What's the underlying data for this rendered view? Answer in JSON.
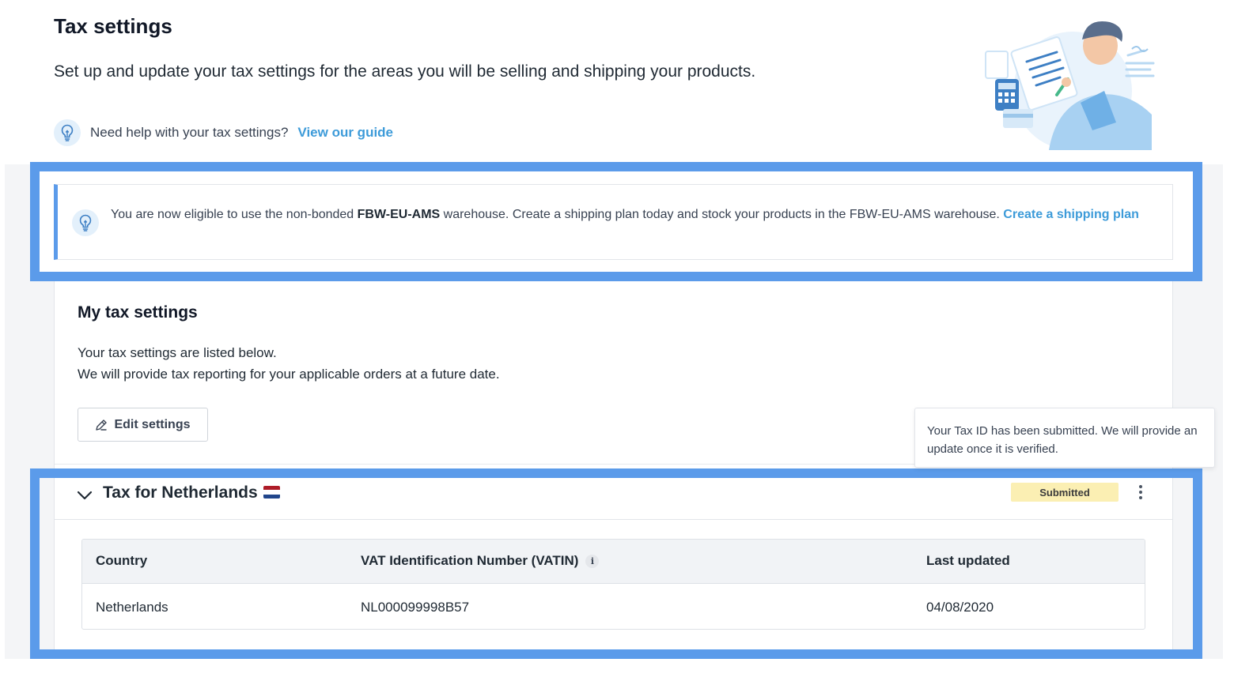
{
  "header": {
    "title": "Tax settings",
    "subtitle": "Set up and update your tax settings for the areas you will be selling and shipping your products.",
    "help_text": "Need help with your tax settings?",
    "help_link": "View our guide"
  },
  "notice": {
    "text_1": "You are now eligible to use the non-bonded ",
    "warehouse_bold": "FBW-EU-AMS",
    "text_2": " warehouse. Create a shipping plan today and stock your products in the FBW-EU-AMS warehouse. ",
    "link": "Create a shipping plan"
  },
  "settings": {
    "title": "My tax settings",
    "desc_1": "Your tax settings are listed below.",
    "desc_2": "We will provide tax reporting for your applicable orders at a future date.",
    "edit_label": "Edit settings"
  },
  "tooltip": {
    "text": "Your Tax ID has been submitted. We will provide an update once it is verified."
  },
  "section": {
    "title": "Tax for Netherlands",
    "status": "Submitted",
    "flag_colors": [
      "#ae1c28",
      "#ffffff",
      "#21468b"
    ]
  },
  "table": {
    "headers": [
      "Country",
      "VAT Identification Number (VATIN)",
      "Last updated"
    ],
    "info_glyph": "i",
    "rows": [
      [
        "Netherlands",
        "NL000099998B57",
        "04/08/2020"
      ]
    ]
  },
  "colors": {
    "link": "#3d9bd9",
    "highlight": "#5b9bea",
    "badge_bg": "#fbefb3"
  }
}
